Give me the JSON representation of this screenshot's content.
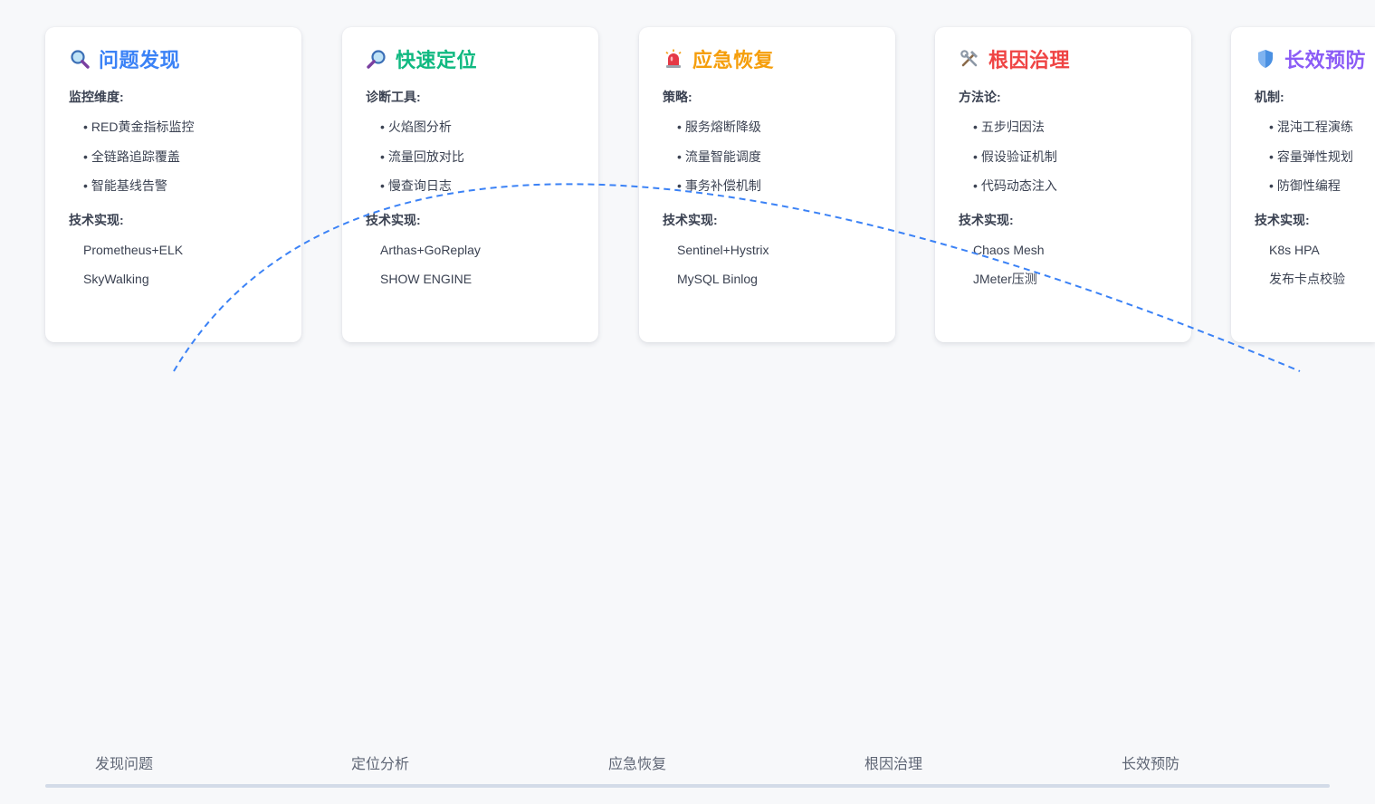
{
  "cards": [
    {
      "title": "问题发现",
      "color": "#3b82f6",
      "icon": "magnifier-left-icon",
      "section1_label": "监控维度:",
      "section1_items": [
        "RED黄金指标监控",
        "全链路追踪覆盖",
        "智能基线告警"
      ],
      "section2_label": "技术实现:",
      "section2_items": [
        "Prometheus+ELK",
        "SkyWalking"
      ]
    },
    {
      "title": "快速定位",
      "color": "#10b981",
      "icon": "magnifier-right-icon",
      "section1_label": "诊断工具:",
      "section1_items": [
        "火焰图分析",
        "流量回放对比",
        "慢查询日志"
      ],
      "section2_label": "技术实现:",
      "section2_items": [
        "Arthas+GoReplay",
        "SHOW ENGINE"
      ]
    },
    {
      "title": "应急恢复",
      "color": "#f59e0b",
      "icon": "siren-light-icon",
      "section1_label": "策略:",
      "section1_items": [
        "服务熔断降级",
        "流量智能调度",
        "事务补偿机制"
      ],
      "section2_label": "技术实现:",
      "section2_items": [
        "Sentinel+Hystrix",
        "MySQL Binlog"
      ]
    },
    {
      "title": "根因治理",
      "color": "#ef4444",
      "icon": "hammer-wrench-icon",
      "section1_label": "方法论:",
      "section1_items": [
        "五步归因法",
        "假设验证机制",
        "代码动态注入"
      ],
      "section2_label": "技术实现:",
      "section2_items": [
        "Chaos Mesh",
        "JMeter压测"
      ]
    },
    {
      "title": "长效预防",
      "color": "#8b5cf6",
      "icon": "shield-icon",
      "section1_label": "机制:",
      "section1_items": [
        "混沌工程演练",
        "容量弹性规划",
        "防御性编程"
      ],
      "section2_label": "技术实现:",
      "section2_items": [
        "K8s HPA",
        "发布卡点校验"
      ]
    }
  ],
  "timeline": [
    "发现问题",
    "定位分析",
    "应急恢复",
    "根因治理",
    "长效预防"
  ],
  "arc_color": "#3b82f6"
}
